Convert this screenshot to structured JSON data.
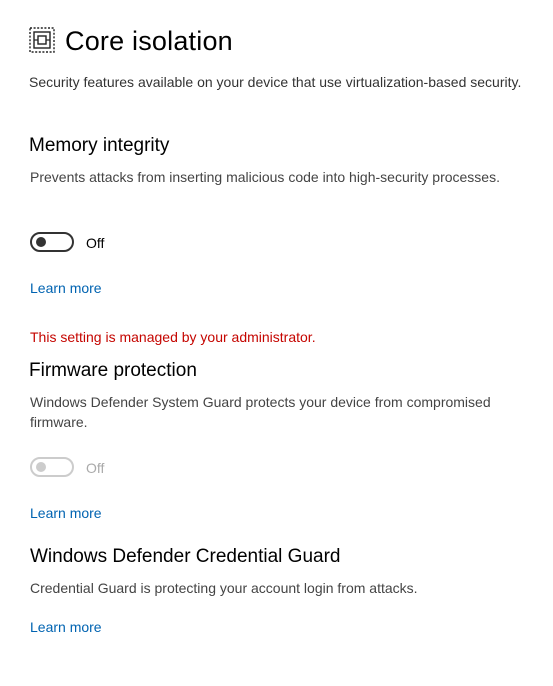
{
  "page": {
    "title": "Core isolation",
    "icon": "core-isolation-chip-icon",
    "description": "Security features available on your device that use virtualization-based security."
  },
  "memory_integrity": {
    "heading": "Memory integrity",
    "description": "Prevents attacks from inserting malicious code into high-security processes.",
    "toggle_state": "Off",
    "toggle_on": false,
    "learn_more": "Learn more",
    "admin_notice": "This setting is managed by your administrator."
  },
  "firmware_protection": {
    "heading": "Firmware protection",
    "description": "Windows Defender System Guard protects your device from compromised firmware.",
    "toggle_state": "Off",
    "toggle_on": false,
    "toggle_disabled": true,
    "learn_more": "Learn more"
  },
  "credential_guard": {
    "heading": "Windows Defender Credential Guard",
    "description": "Credential Guard is protecting your account login from attacks.",
    "learn_more": "Learn more"
  },
  "colors": {
    "link": "#0063b1",
    "warning": "#c50500",
    "toggle_off": "#333333",
    "toggle_disabled": "#cccccc"
  }
}
